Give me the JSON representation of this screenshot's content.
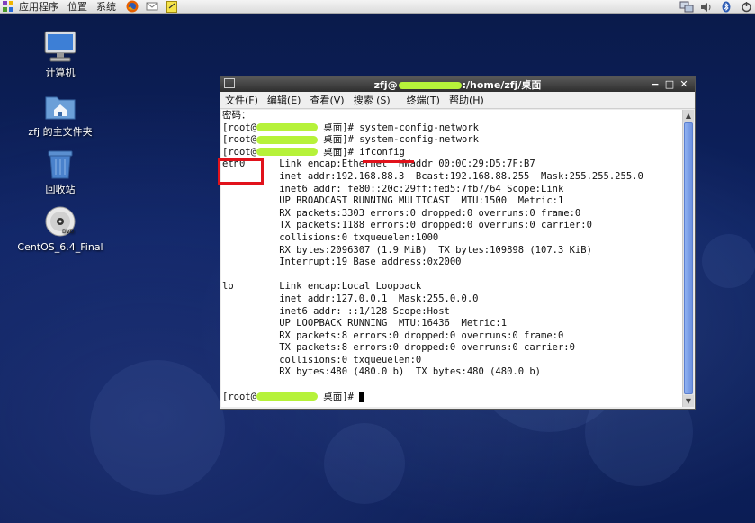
{
  "top_panel": {
    "menu": [
      "应用程序",
      "位置",
      "系统"
    ],
    "launchers": [
      "firefox-icon",
      "mail-icon",
      "notes-icon"
    ],
    "tray": [
      "network-icon",
      "volume-icon",
      "bluetooth-icon",
      "power-icon"
    ]
  },
  "desktop": {
    "icons": [
      {
        "label": "计算机",
        "icon": "computer-icon"
      },
      {
        "label": "zfj 的主文件夹",
        "icon": "home-folder-icon"
      },
      {
        "label": "回收站",
        "icon": "trash-icon"
      },
      {
        "label": "CentOS_6.4_Final",
        "icon": "dvd-icon"
      }
    ]
  },
  "terminal": {
    "title_prefix": "zfj@",
    "title_suffix": ":/home/zfj/桌面",
    "menu": [
      "文件(F)",
      "编辑(E)",
      "查看(V)",
      "搜索 (S)",
      "终端(T)",
      "帮助(H)"
    ],
    "prompt_open": "[root@",
    "prompt_close": " 桌面]# ",
    "lines": {
      "l0": "密码：",
      "cmd1": "system-config-network",
      "cmd2": "system-config-network",
      "cmd3": "ifconfig",
      "e0": "eth0      Link encap:Ethernet  HWaddr 00:0C:29:D5:7F:B7",
      "e1": "          inet addr:192.168.88.3  Bcast:192.168.88.255  Mask:255.255.255.0",
      "e2": "          inet6 addr: fe80::20c:29ff:fed5:7fb7/64 Scope:Link",
      "e3": "          UP BROADCAST RUNNING MULTICAST  MTU:1500  Metric:1",
      "e4": "          RX packets:3303 errors:0 dropped:0 overruns:0 frame:0",
      "e5": "          TX packets:1188 errors:0 dropped:0 overruns:0 carrier:0",
      "e6": "          collisions:0 txqueuelen:1000",
      "e7": "          RX bytes:2096307 (1.9 MiB)  TX bytes:109898 (107.3 KiB)",
      "e8": "          Interrupt:19 Base address:0x2000",
      "o0": "lo        Link encap:Local Loopback",
      "o1": "          inet addr:127.0.0.1  Mask:255.0.0.0",
      "o2": "          inet6 addr: ::1/128 Scope:Host",
      "o3": "          UP LOOPBACK RUNNING  MTU:16436  Metric:1",
      "o4": "          RX packets:8 errors:0 dropped:0 overruns:0 frame:0",
      "o5": "          TX packets:8 errors:0 dropped:0 overruns:0 carrier:0",
      "o6": "          collisions:0 txqueuelen:0",
      "o7": "          RX bytes:480 (480.0 b)  TX bytes:480 (480.0 b)"
    }
  },
  "colors": {
    "annotation": "#e1121b",
    "redaction": "#b6f23a"
  }
}
